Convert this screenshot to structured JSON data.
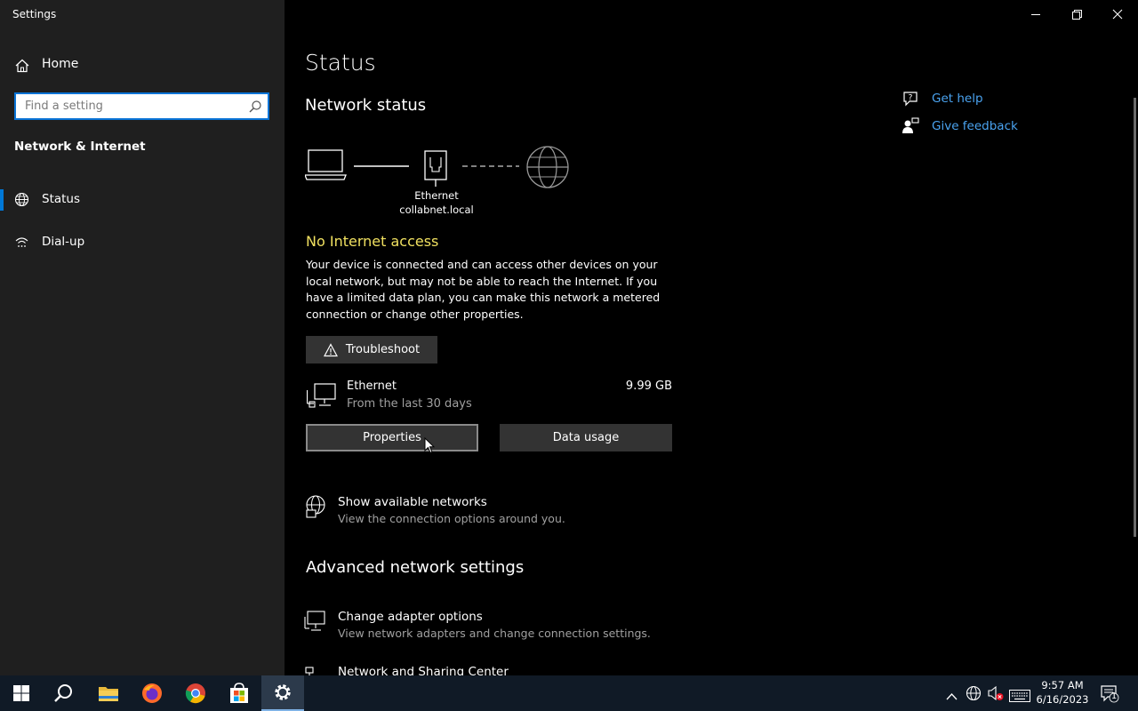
{
  "window": {
    "title": "Settings"
  },
  "sidebar": {
    "home_label": "Home",
    "search_placeholder": "Find a setting",
    "section_title": "Network & Internet",
    "items": [
      {
        "label": "Status",
        "icon": "globe-icon",
        "active": true
      },
      {
        "label": "Dial-up",
        "icon": "dialup-icon",
        "active": false
      }
    ]
  },
  "main": {
    "title": "Status",
    "network_status_heading": "Network status",
    "diagram": {
      "adapter_name": "Ethernet",
      "network_name": "collabnet.local"
    },
    "connection_state": "No Internet access",
    "description": "Your device is connected and can access other devices on your local network, but may not be able to reach the Internet. If you have a limited data plan, you can make this network a metered connection or change other properties.",
    "troubleshoot_label": "Troubleshoot",
    "usage": {
      "name": "Ethernet",
      "period": "From the last 30 days",
      "amount": "9.99 GB"
    },
    "properties_label": "Properties",
    "data_usage_label": "Data usage",
    "show_networks": {
      "title": "Show available networks",
      "subtitle": "View the connection options around you."
    },
    "advanced_heading": "Advanced network settings",
    "change_adapter": {
      "title": "Change adapter options",
      "subtitle": "View network adapters and change connection settings."
    },
    "sharing_center": {
      "title": "Network and Sharing Center"
    }
  },
  "help": {
    "get_help": "Get help",
    "give_feedback": "Give feedback"
  },
  "taskbar": {
    "apps": [
      "start-icon",
      "search-icon",
      "file-explorer-icon",
      "firefox-icon",
      "chrome-icon",
      "store-icon",
      "settings-icon"
    ],
    "time": "9:57 AM",
    "date": "6/16/2023",
    "notification_count": "1"
  },
  "colors": {
    "accent": "#0078d7",
    "warning": "#f0e060",
    "link": "#4aa3f0"
  }
}
